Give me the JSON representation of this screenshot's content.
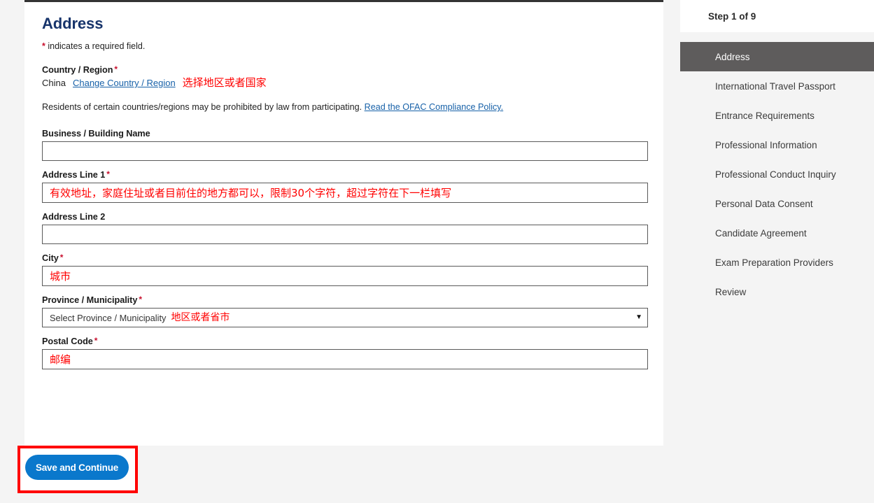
{
  "form": {
    "title": "Address",
    "required_note_star": "*",
    "required_note": " indicates a required field.",
    "country_label": "Country / Region",
    "country_value": "China",
    "change_country_link": "Change Country / Region",
    "country_annotation": "选择地区或者国家",
    "ofac_text": "Residents of certain countries/regions may be prohibited by law from participating. ",
    "ofac_link": "Read the OFAC Compliance Policy.",
    "business_label": "Business / Building Name",
    "business_value": "",
    "address1_label": "Address Line 1",
    "address1_value": "有效地址，家庭住址或者目前住的地方都可以，限制30个字符，超过字符在下一栏填写",
    "address2_label": "Address Line 2",
    "address2_value": "",
    "city_label": "City",
    "city_value": "城市",
    "province_label": "Province / Municipality",
    "province_selected": "Select Province / Municipality",
    "province_annotation": "地区或者省市",
    "province_arrow": "▼",
    "postal_label": "Postal Code",
    "postal_value": "邮编",
    "submit_label": "Save and Continue"
  },
  "sidebar": {
    "step_text": "Step 1 of 9",
    "items": [
      {
        "label": "Address",
        "active": true
      },
      {
        "label": "International Travel Passport",
        "active": false
      },
      {
        "label": "Entrance Requirements",
        "active": false
      },
      {
        "label": "Professional Information",
        "active": false
      },
      {
        "label": "Professional Conduct Inquiry",
        "active": false
      },
      {
        "label": "Personal Data Consent",
        "active": false
      },
      {
        "label": "Candidate Agreement",
        "active": false
      },
      {
        "label": "Exam Preparation Providers",
        "active": false
      },
      {
        "label": "Review",
        "active": false
      }
    ]
  },
  "colors": {
    "heading": "#17346b",
    "required_star": "#c8102e",
    "link": "#1761a8",
    "annotation": "#ff0000",
    "button": "#0a78cc",
    "highlight_box": "#ff0000",
    "sidebar_active": "#5e5c5c",
    "page_bg": "#f4f4f4"
  }
}
